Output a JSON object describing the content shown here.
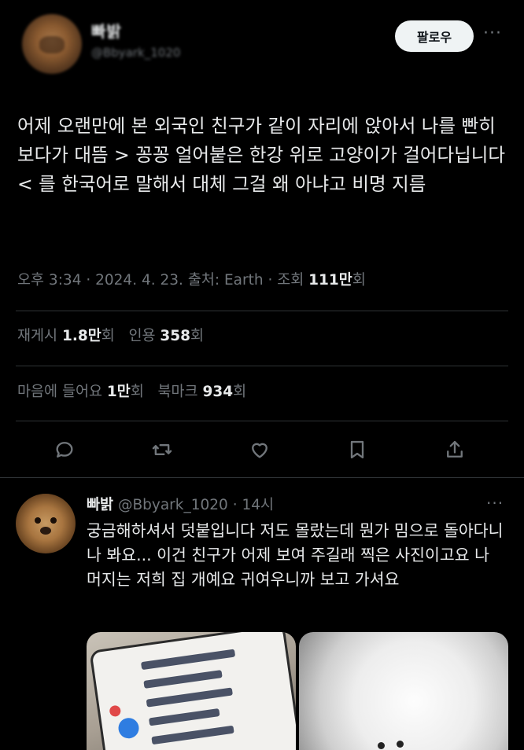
{
  "author": {
    "name": "빠밝",
    "handle": "@Bbyark_1020"
  },
  "follow_label": "팔로우",
  "more_label": "···",
  "tweet": {
    "text": "어제 오랜만에 본 외국인 친구가 같이 자리에 앉아서 나를 빤히 보다가 대뜸 > 꽁꽁 얼어붙은 한강 위로 고양이가 걸어다닙니다 < 를 한국어로 말해서 대체 그걸 왜 아냐고 비명 지름",
    "time": "오후 3:34",
    "date": "2024. 4. 23.",
    "source": "출처: Earth",
    "views_label": "조회",
    "views_count": "111만",
    "views_suffix": "회"
  },
  "stats": {
    "retweets_label": "재게시",
    "retweets_count": "1.8만",
    "quotes_label": "인용",
    "quotes_count": "358",
    "likes_label": "마음에 들어요",
    "likes_count": "1만",
    "bookmarks_label": "북마크",
    "bookmarks_count": "934",
    "unit": "회"
  },
  "actions": [
    "reply-icon",
    "retweet-icon",
    "heart-icon",
    "bookmark-icon",
    "share-icon"
  ],
  "reply": {
    "name": "빠밝",
    "handle": "@Bbyark_1020",
    "time": "14시",
    "text": "궁금해하셔서 덧붙입니다 저도 몰랐는데 뭔가 밈으로 돌아다니나 봐요... 이건 친구가 어제 보여 주길래 찍은 사진이고요 나머지는 저희 집 개예요 귀여우니까 보고 가셔요"
  },
  "colors": {
    "background": "#000000",
    "text": "#e7e9ea",
    "muted": "#71767b",
    "divider": "#2f3336"
  }
}
